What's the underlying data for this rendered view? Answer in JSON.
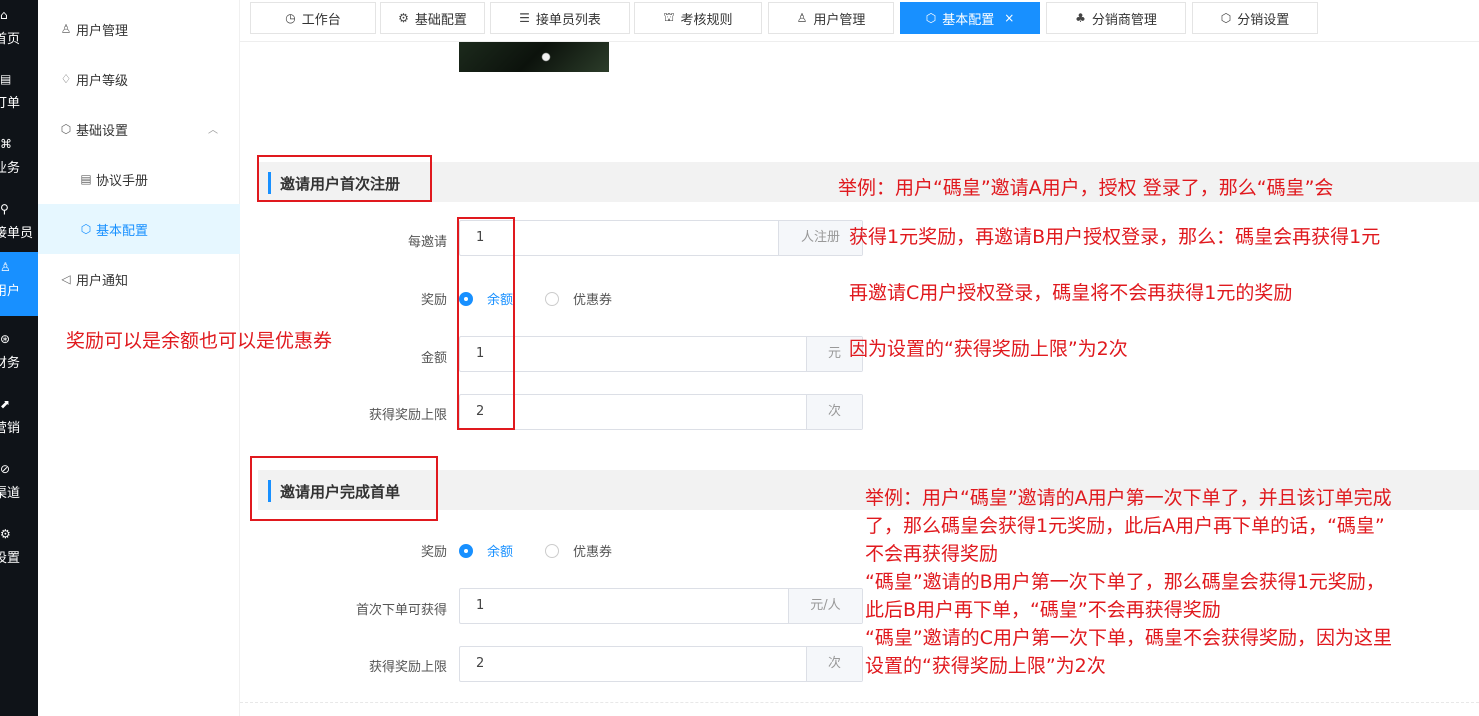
{
  "rail": {
    "items": [
      {
        "icon": "home-icon",
        "glyph": "⌂",
        "label": "首页"
      },
      {
        "icon": "order-icon",
        "glyph": "▤",
        "label": "订单"
      },
      {
        "icon": "business-icon",
        "glyph": "⌘",
        "label": "业务"
      },
      {
        "icon": "bike-icon",
        "glyph": "⚲",
        "label": "接单员"
      },
      {
        "icon": "user-icon",
        "glyph": "♙",
        "label": "用户"
      },
      {
        "icon": "finance-icon",
        "glyph": "⊛",
        "label": "财务"
      },
      {
        "icon": "marketing-icon",
        "glyph": "⬈",
        "label": "营销"
      },
      {
        "icon": "channel-icon",
        "glyph": "⊘",
        "label": "渠道"
      },
      {
        "icon": "settings-icon",
        "glyph": "⚙",
        "label": "设置"
      }
    ]
  },
  "subnav": {
    "items": [
      {
        "icon": "user-icon",
        "glyph": "♙",
        "label": "用户管理"
      },
      {
        "icon": "diamond-icon",
        "glyph": "♢",
        "label": "用户等级"
      },
      {
        "icon": "hexagon-icon",
        "glyph": "⬡",
        "label": "基础设置",
        "arrow": "︿"
      },
      {
        "icon": "document-icon",
        "glyph": "▤",
        "label": "协议手册"
      },
      {
        "icon": "hexagon-icon",
        "glyph": "⬡",
        "label": "基本配置"
      },
      {
        "icon": "speaker-icon",
        "glyph": "◁",
        "label": "用户通知"
      }
    ]
  },
  "tabs": [
    {
      "icon": "dashboard-icon",
      "glyph": "◷",
      "label": "工作台"
    },
    {
      "icon": "gear-icon",
      "glyph": "⚙",
      "label": "基础配置"
    },
    {
      "icon": "list-icon",
      "glyph": "☰",
      "label": "接单员列表"
    },
    {
      "icon": "rule-icon",
      "glyph": "⛫",
      "label": "考核规则"
    },
    {
      "icon": "user-icon",
      "glyph": "♙",
      "label": "用户管理"
    },
    {
      "icon": "hexagon-icon",
      "glyph": "⬡",
      "label": "基本配置",
      "close": "×"
    },
    {
      "icon": "org-icon",
      "glyph": "♣",
      "label": "分销商管理"
    },
    {
      "icon": "hexagon-icon",
      "glyph": "⬡",
      "label": "分销设置"
    }
  ],
  "section1": {
    "title": "邀请用户首次注册",
    "per_invite_label": "每邀请",
    "per_invite_value": "1",
    "per_invite_suffix": "人注册",
    "reward_label": "奖励",
    "reward_options": [
      "余额",
      "优惠券"
    ],
    "reward_selected": "余额",
    "amount_label": "金额",
    "amount_value": "1",
    "amount_suffix": "元",
    "limit_label": "获得奖励上限",
    "limit_value": "2",
    "limit_suffix": "次"
  },
  "section2": {
    "title": "邀请用户完成首单",
    "reward_label": "奖励",
    "reward_options": [
      "余额",
      "优惠券"
    ],
    "reward_selected": "余额",
    "first_order_label": "首次下单可获得",
    "first_order_value": "1",
    "first_order_suffix": "元/人",
    "limit_label": "获得奖励上限",
    "limit_value": "2",
    "limit_suffix": "次"
  },
  "annotations": {
    "reward_note": "奖励可以是余额也可以是优惠券",
    "example1": [
      "举例：用户“碼皇”邀请A用户，授权 登录了，那么“碼皇”会",
      "获得1元奖励，再邀请B用户授权登录，那么：碼皇会再获得1元",
      "再邀请C用户授权登录，碼皇将不会再获得1元的奖励",
      "因为设置的“获得奖励上限”为2次"
    ],
    "example2": [
      "举例：用户“碼皇”邀请的A用户第一次下单了，并且该订单完成",
      "了，那么碼皇会获得1元奖励，此后A用户再下单的话，“碼皇”",
      "不会再获得奖励",
      " “碼皇”邀请的B用户第一次下单了，那么碼皇会获得1元奖励，",
      "此后B用户再下单，“碼皇”不会再获得奖励",
      " “碼皇”邀请的C用户第一次下单，碼皇不会获得奖励，因为这里",
      "设置的“获得奖励上限”为2次"
    ]
  },
  "colors": {
    "accent": "#1890ff",
    "annotation_red": "#e0191e",
    "rail_bg": "#0f1318"
  }
}
